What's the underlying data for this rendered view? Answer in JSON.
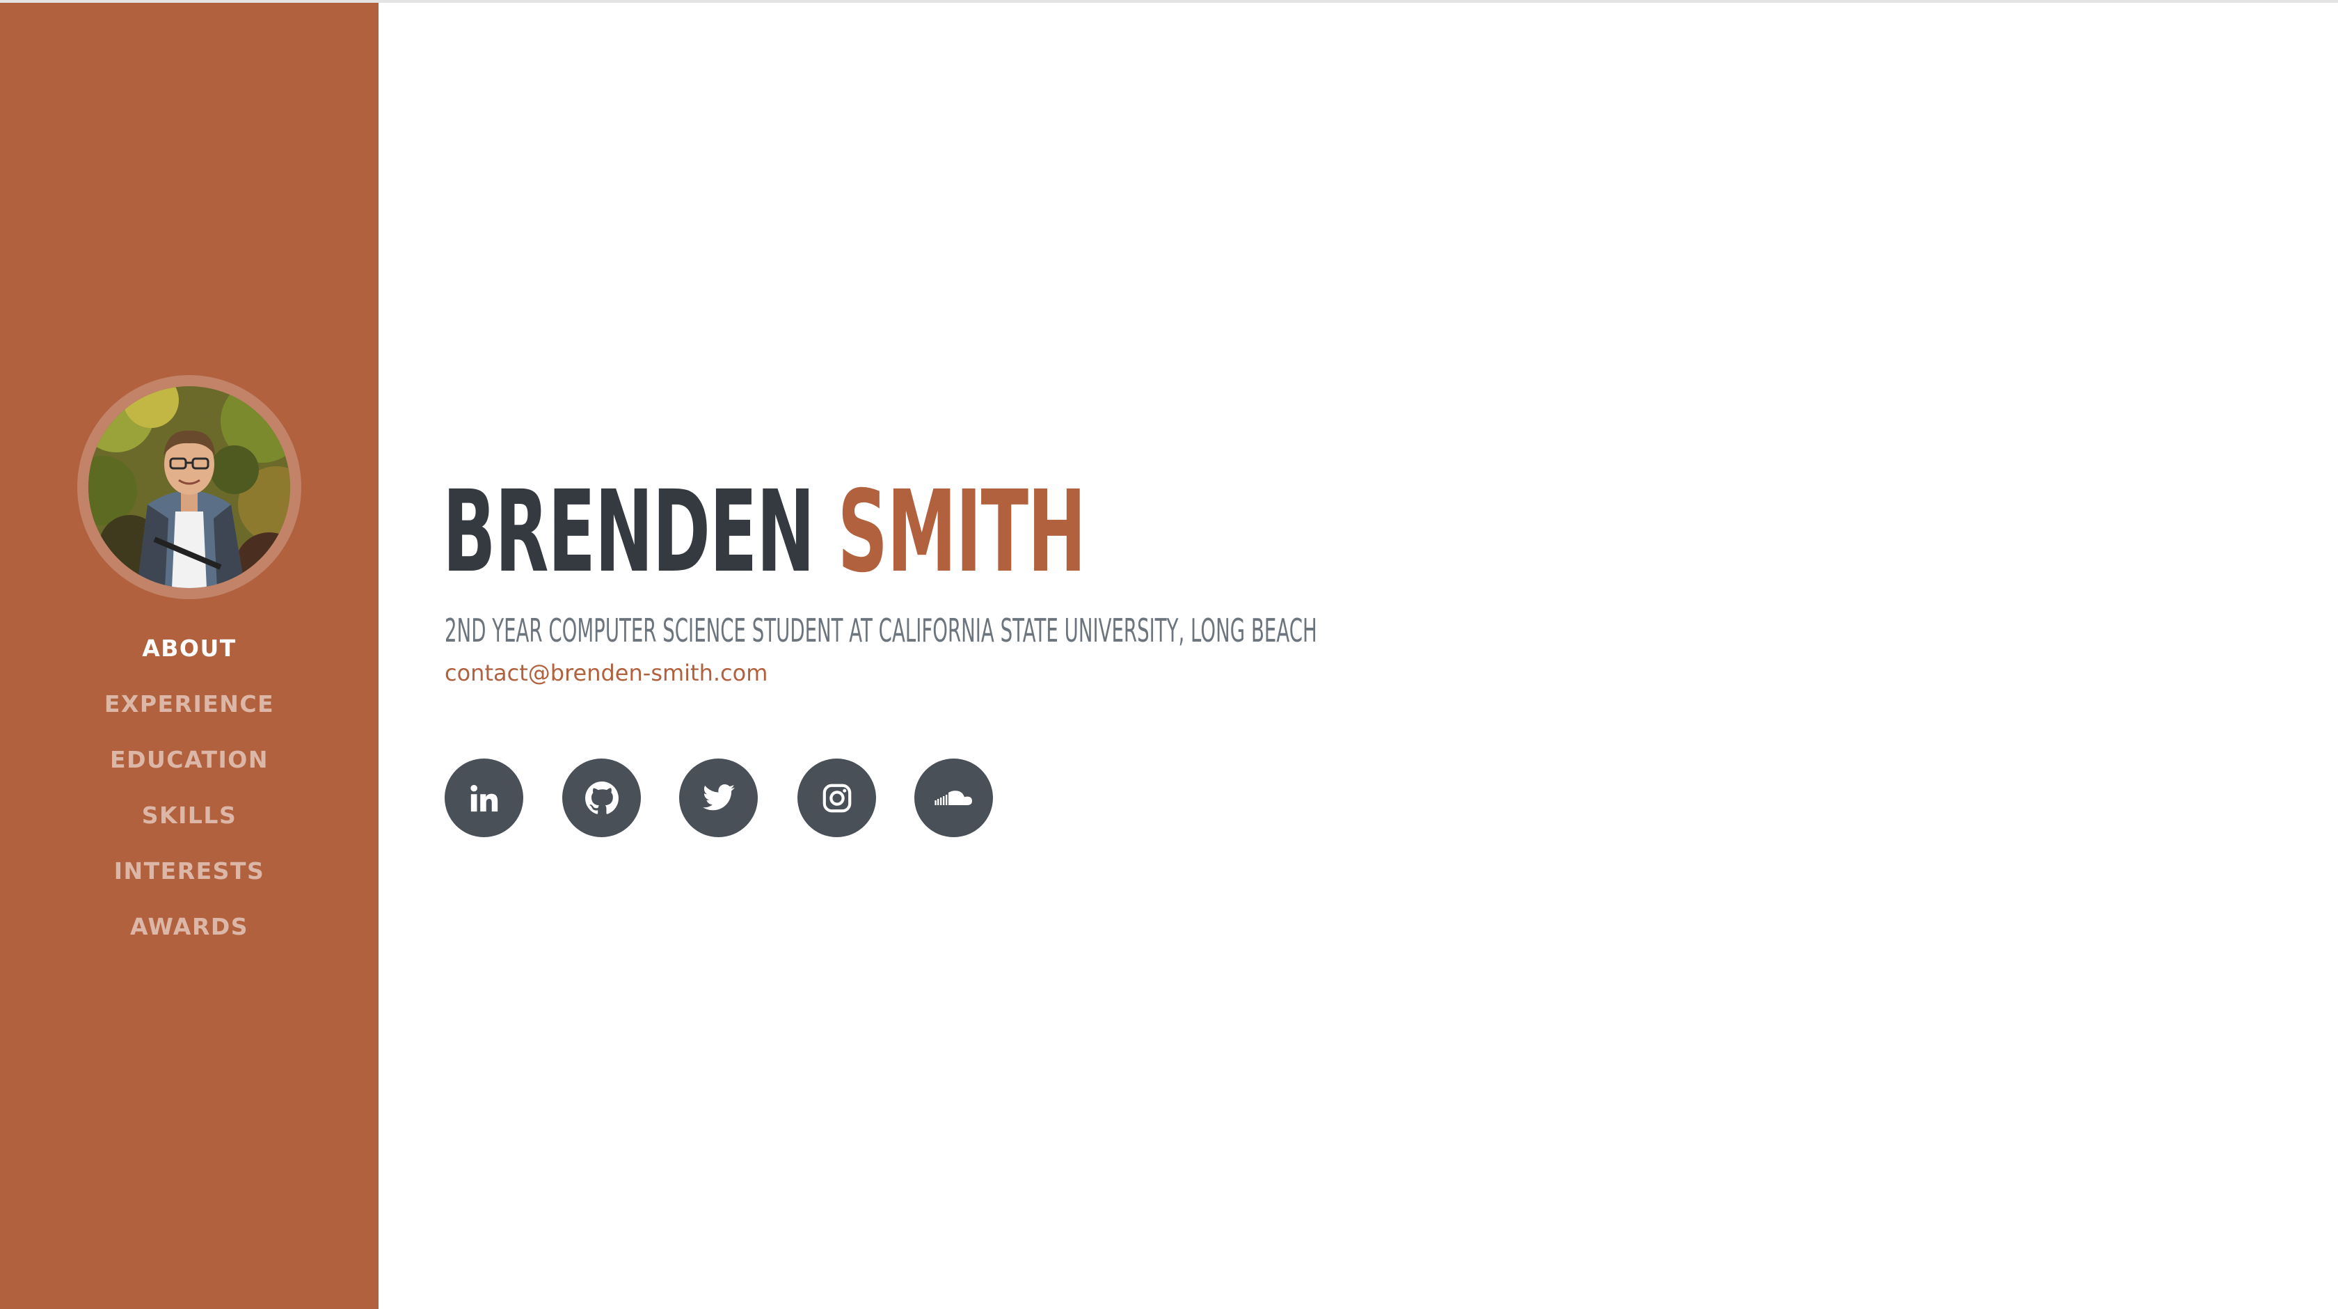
{
  "profile": {
    "first_name": "BRENDEN",
    "last_name": "SMITH",
    "subheading": "2ND YEAR COMPUTER SCIENCE STUDENT AT CALIFORNIA STATE UNIVERSITY, LONG BEACH",
    "email": "contact@brenden-smith.com"
  },
  "nav": {
    "items": [
      {
        "label": "ABOUT"
      },
      {
        "label": "EXPERIENCE"
      },
      {
        "label": "EDUCATION"
      },
      {
        "label": "SKILLS"
      },
      {
        "label": "INTERESTS"
      },
      {
        "label": "AWARDS"
      }
    ],
    "active": "ABOUT"
  },
  "social": {
    "icons": [
      "linkedin-icon",
      "github-icon",
      "twitter-icon",
      "instagram-icon",
      "soundcloud-icon"
    ]
  },
  "colors": {
    "accent": "#b2613e",
    "dark": "#343a40",
    "muted": "#6c757d",
    "icon_bg": "#495057"
  }
}
